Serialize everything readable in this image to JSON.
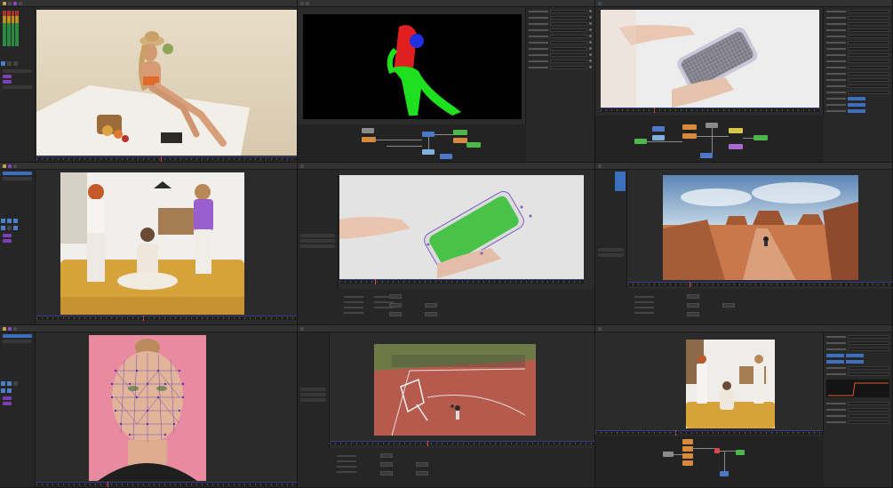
{
  "cells": [
    {
      "id": "cell-beach",
      "tab": "",
      "overlay": ""
    },
    {
      "id": "cell-matte",
      "tab": "",
      "overlay": ""
    },
    {
      "id": "cell-phone-track",
      "tab": "",
      "overlay": ""
    },
    {
      "id": "cell-kids-sofa",
      "tab": "",
      "overlay": ""
    },
    {
      "id": "cell-green-screen-phone",
      "tab": "",
      "overlay": ""
    },
    {
      "id": "cell-desert",
      "tab": "",
      "overlay": ""
    },
    {
      "id": "cell-face-mesh",
      "tab": "",
      "overlay": ""
    },
    {
      "id": "cell-basketball",
      "tab": "",
      "overlay": ""
    },
    {
      "id": "cell-kids-sofa-2",
      "tab": "",
      "overlay": ""
    }
  ],
  "icons": {
    "play": "play-icon",
    "stop": "stop-icon",
    "step": "step-icon"
  },
  "colors": {
    "accent_blue": "#3c6fbd",
    "accent_purple": "#8a46c8",
    "matte_red": "#e02020",
    "matte_green": "#1fe01f",
    "matte_blue": "#2030e0",
    "node_orange": "#d78a3b",
    "node_green": "#4fb54f"
  }
}
